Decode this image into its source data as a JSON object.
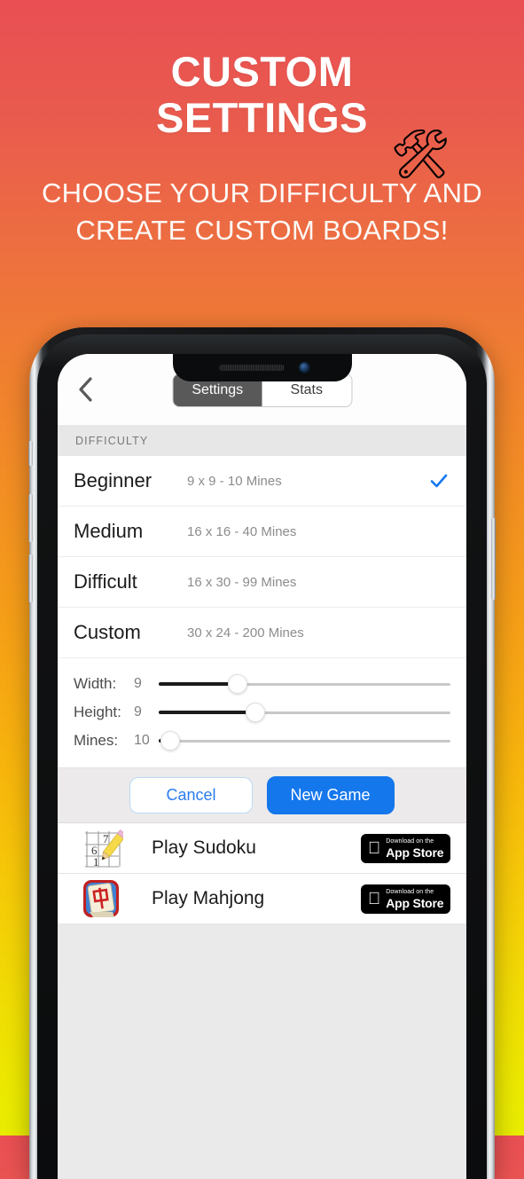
{
  "promo": {
    "title_line1": "CUSTOM",
    "title_line2": "SETTINGS",
    "tool_icon": "🛠",
    "subtitle": "CHOOSE YOUR DIFFICULTY AND CREATE CUSTOM BOARDS!",
    "bg_top_color": "#e94f53",
    "bg_bottom_color": "#e8ec00"
  },
  "app": {
    "nav": {
      "back_icon": "chevron-left-icon",
      "segments": [
        {
          "label": "Settings",
          "selected": true
        },
        {
          "label": "Stats",
          "selected": false
        }
      ]
    },
    "section_header": "DIFFICULTY",
    "difficulties": [
      {
        "name": "Beginner",
        "desc": "9 x 9 - 10 Mines",
        "selected": true
      },
      {
        "name": "Medium",
        "desc": "16 x 16 - 40 Mines",
        "selected": false
      },
      {
        "name": "Difficult",
        "desc": "16 x 30 - 99 Mines",
        "selected": false
      },
      {
        "name": "Custom",
        "desc": "30 x 24 - 200 Mines",
        "selected": false
      }
    ],
    "sliders": [
      {
        "label": "Width:",
        "value": "9",
        "percent": 27
      },
      {
        "label": "Height:",
        "value": "9",
        "percent": 33
      },
      {
        "label": "Mines:",
        "value": "10",
        "percent": 4
      }
    ],
    "buttons": {
      "cancel": "Cancel",
      "new_game": "New Game",
      "cancel_color": "#2a7ced",
      "new_game_color": "#1577ec"
    },
    "promos": [
      {
        "name": "Play Sudoku",
        "icon": "sudoku-icon",
        "store_small": "Download on the",
        "store_big": "App Store"
      },
      {
        "name": "Play Mahjong",
        "icon": "mahjong-icon",
        "store_small": "Download on the",
        "store_big": "App Store"
      }
    ],
    "accent_check_color": "#1477ef"
  }
}
